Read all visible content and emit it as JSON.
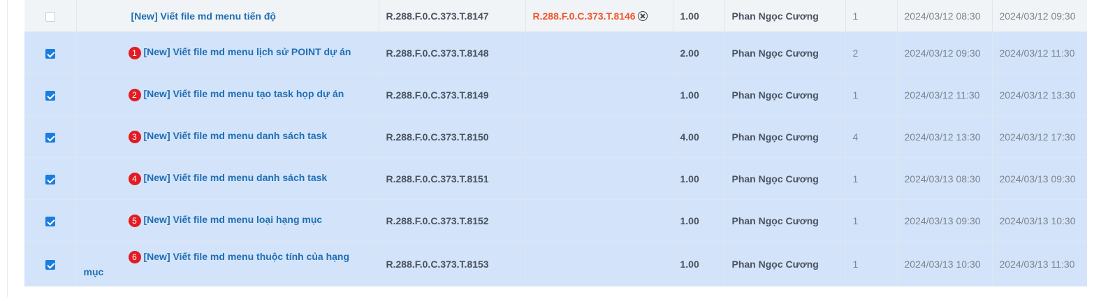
{
  "rows": [
    {
      "checked": false,
      "badge": "",
      "name": "[New] Viết file md menu tiến độ",
      "code": "R.288.F.0.C.373.T.8147",
      "parent_code": "R.288.F.0.C.373.T.8146",
      "hours": "1.00",
      "assignee": "Phan Ngọc Cương",
      "count": "1",
      "start": "2024/03/12 08:30",
      "end": "2024/03/12 09:30"
    },
    {
      "checked": true,
      "badge": "1",
      "name": "[New] Viết file md menu lịch sử POINT dự án",
      "code": "R.288.F.0.C.373.T.8148",
      "parent_code": "",
      "hours": "2.00",
      "assignee": "Phan Ngọc Cương",
      "count": "2",
      "start": "2024/03/12 09:30",
      "end": "2024/03/12 11:30"
    },
    {
      "checked": true,
      "badge": "2",
      "name": "[New] Viết file md menu tạo task họp dự án",
      "code": "R.288.F.0.C.373.T.8149",
      "parent_code": "",
      "hours": "1.00",
      "assignee": "Phan Ngọc Cương",
      "count": "1",
      "start": "2024/03/12 11:30",
      "end": "2024/03/12 13:30"
    },
    {
      "checked": true,
      "badge": "3",
      "name": "[New] Viết file md menu danh sách task",
      "code": "R.288.F.0.C.373.T.8150",
      "parent_code": "",
      "hours": "4.00",
      "assignee": "Phan Ngọc Cương",
      "count": "4",
      "start": "2024/03/12 13:30",
      "end": "2024/03/12 17:30"
    },
    {
      "checked": true,
      "badge": "4",
      "name": "[New] Viết file md menu danh sách task",
      "code": "R.288.F.0.C.373.T.8151",
      "parent_code": "",
      "hours": "1.00",
      "assignee": "Phan Ngọc Cương",
      "count": "1",
      "start": "2024/03/13 08:30",
      "end": "2024/03/13 09:30"
    },
    {
      "checked": true,
      "badge": "5",
      "name": "[New] Viết file md menu loại hạng mục",
      "code": "R.288.F.0.C.373.T.8152",
      "parent_code": "",
      "hours": "1.00",
      "assignee": "Phan Ngọc Cương",
      "count": "1",
      "start": "2024/03/13 09:30",
      "end": "2024/03/13 10:30"
    },
    {
      "checked": true,
      "badge": "6",
      "name": "[New] Viết file md menu thuộc tính của hạng mục",
      "code": "R.288.F.0.C.373.T.8153",
      "parent_code": "",
      "hours": "1.00",
      "assignee": "Phan Ngọc Cương",
      "count": "1",
      "start": "2024/03/13 10:30",
      "end": "2024/03/13 11:30"
    }
  ],
  "colors": {
    "selected_row_bg": "#d3e3fa",
    "unselected_row_bg": "#f1f4f7",
    "task_link": "#1f6fb3",
    "parent_code": "#f0552d",
    "badge": "#e31b23",
    "checkbox_checked": "#1a7ee0"
  }
}
